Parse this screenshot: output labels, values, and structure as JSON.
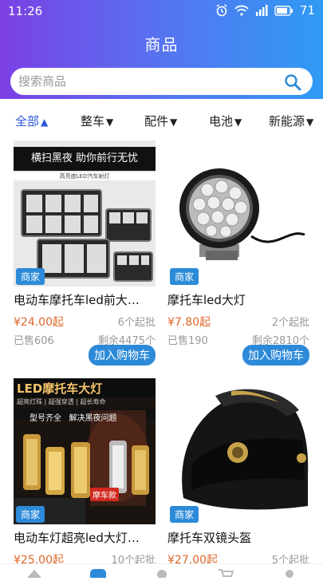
{
  "status_bar": {
    "time": "11:26",
    "battery": "71"
  },
  "header": {
    "title": "商品"
  },
  "search": {
    "placeholder": "搜索商品"
  },
  "filters": [
    {
      "label": "全部",
      "active": true
    },
    {
      "label": "整车"
    },
    {
      "label": "配件"
    },
    {
      "label": "电池"
    },
    {
      "label": "新能源"
    }
  ],
  "products": [
    {
      "badge": "商家",
      "name": "电动车摩托车led前大…",
      "price": "¥24.00起",
      "min_qty": "6个起批",
      "sold": "已售606",
      "stock": "剩余4475个",
      "button": "加入购物车",
      "image_text": {
        "banner": "横扫黑夜 助你前行无忧",
        "sub": "高亮度LED汽车射灯"
      }
    },
    {
      "badge": "商家",
      "name": "摩托车led大灯",
      "price": "¥7.80起",
      "min_qty": "2个起批",
      "sold": "已售190",
      "stock": "剩余2810个",
      "button": "加入购物车"
    },
    {
      "badge": "商家",
      "name": "电动车灯超亮led大灯…",
      "price": "¥25.00起",
      "min_qty": "10个起批",
      "image_text": {
        "banner": "LED摩托车大灯",
        "sub": "超亮灯珠 | 超强穿透 | 超长寿命",
        "tags": "型号齐全   解决黑夜问题",
        "stamp": "摩车款"
      }
    },
    {
      "badge": "商家",
      "name": "摩托车双镜头盔",
      "price": "¥27.00起",
      "min_qty": "5个起批"
    }
  ],
  "colors": {
    "accent": "#2c8ad8",
    "price": "#e0672a",
    "active_filter": "#2b55d8"
  },
  "icons": [
    "alarm-icon",
    "wifi-icon",
    "signal-icon",
    "battery-icon",
    "search-icon",
    "home-tab-icon",
    "category-tab-icon",
    "user-tab-icon",
    "cart-tab-icon",
    "profile-tab-icon"
  ]
}
